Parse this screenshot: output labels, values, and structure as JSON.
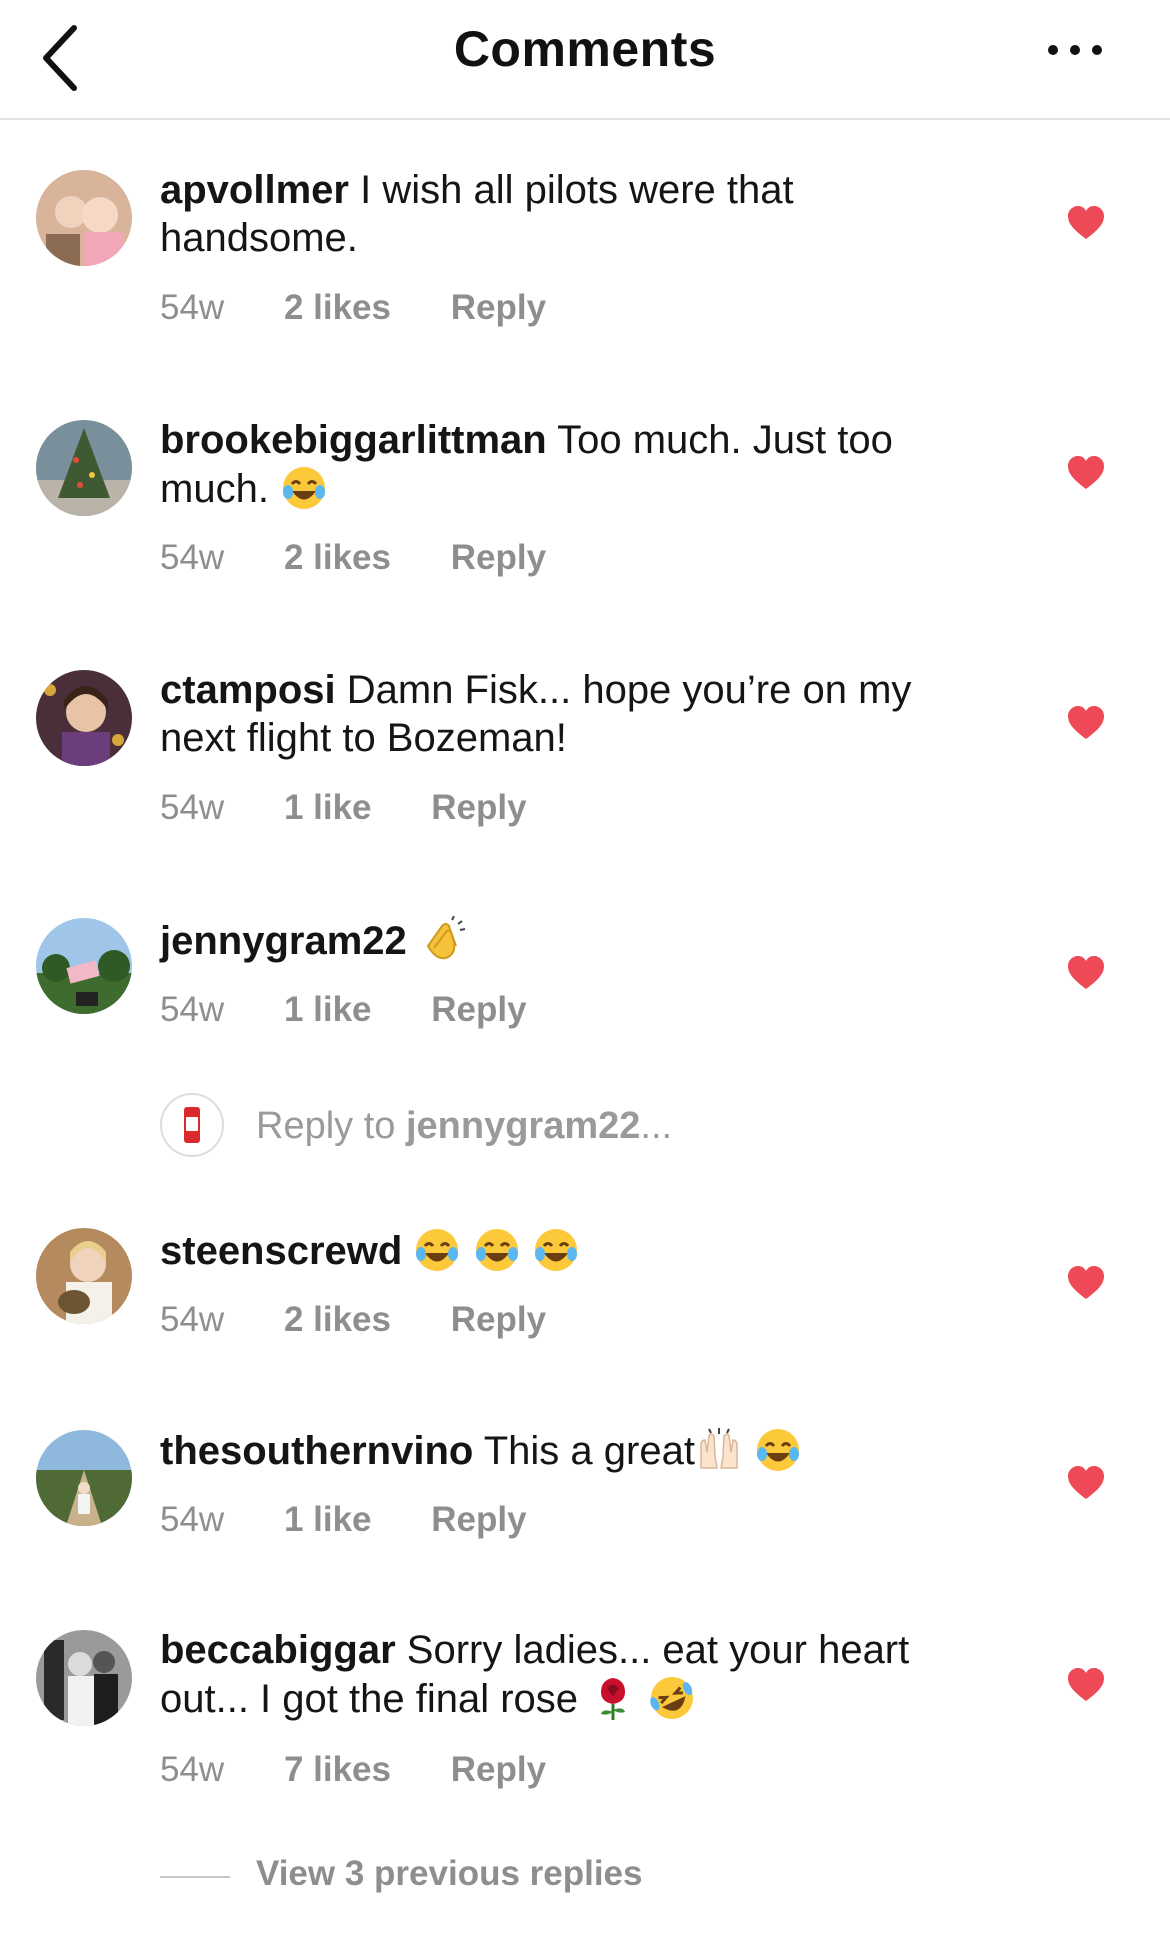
{
  "header": {
    "title": "Comments",
    "back_icon": "chevron-left-icon",
    "more_icon": "ellipsis-icon"
  },
  "colors": {
    "heart": "#ed4956",
    "meta_text": "#8e8e8e",
    "divider": "#e2e2e2"
  },
  "comments": [
    {
      "username": "apvollmer",
      "text": "I wish all pilots were that handsome.",
      "emojis": [],
      "time": "54w",
      "likes": "2 likes",
      "reply": "Reply"
    },
    {
      "username": "brookebiggarlittman",
      "text": "Too much. Just too much.",
      "emojis": [
        "face-with-tears-of-joy"
      ],
      "time": "54w",
      "likes": "2 likes",
      "reply": "Reply"
    },
    {
      "username": "ctamposi",
      "text": "Damn Fisk... hope you’re on my next flight to Bozeman!",
      "emojis": [],
      "time": "54w",
      "likes": "1 like",
      "reply": "Reply"
    },
    {
      "username": "jennygram22",
      "text": "",
      "emojis": [
        "clapping-hands"
      ],
      "time": "54w",
      "likes": "1 like",
      "reply": "Reply"
    },
    {
      "username": "steenscrewd",
      "text": "",
      "emojis": [
        "face-with-tears-of-joy",
        "face-with-tears-of-joy",
        "face-with-tears-of-joy"
      ],
      "time": "54w",
      "likes": "2 likes",
      "reply": "Reply"
    },
    {
      "username": "thesouthernvino",
      "text": "This a great",
      "emojis": [
        "raising-hands",
        "face-with-tears-of-joy"
      ],
      "time": "54w",
      "likes": "1 like",
      "reply": "Reply"
    },
    {
      "username": "beccabiggar",
      "text": "Sorry ladies... eat your heart out... I got the final rose",
      "emojis": [
        "rose",
        "rolling-on-floor-laughing"
      ],
      "time": "54w",
      "likes": "7 likes",
      "reply": "Reply"
    }
  ],
  "reply_box": {
    "prefix": "Reply to ",
    "username": "jennygram22",
    "suffix": "..."
  },
  "view_previous": "View 3 previous replies"
}
